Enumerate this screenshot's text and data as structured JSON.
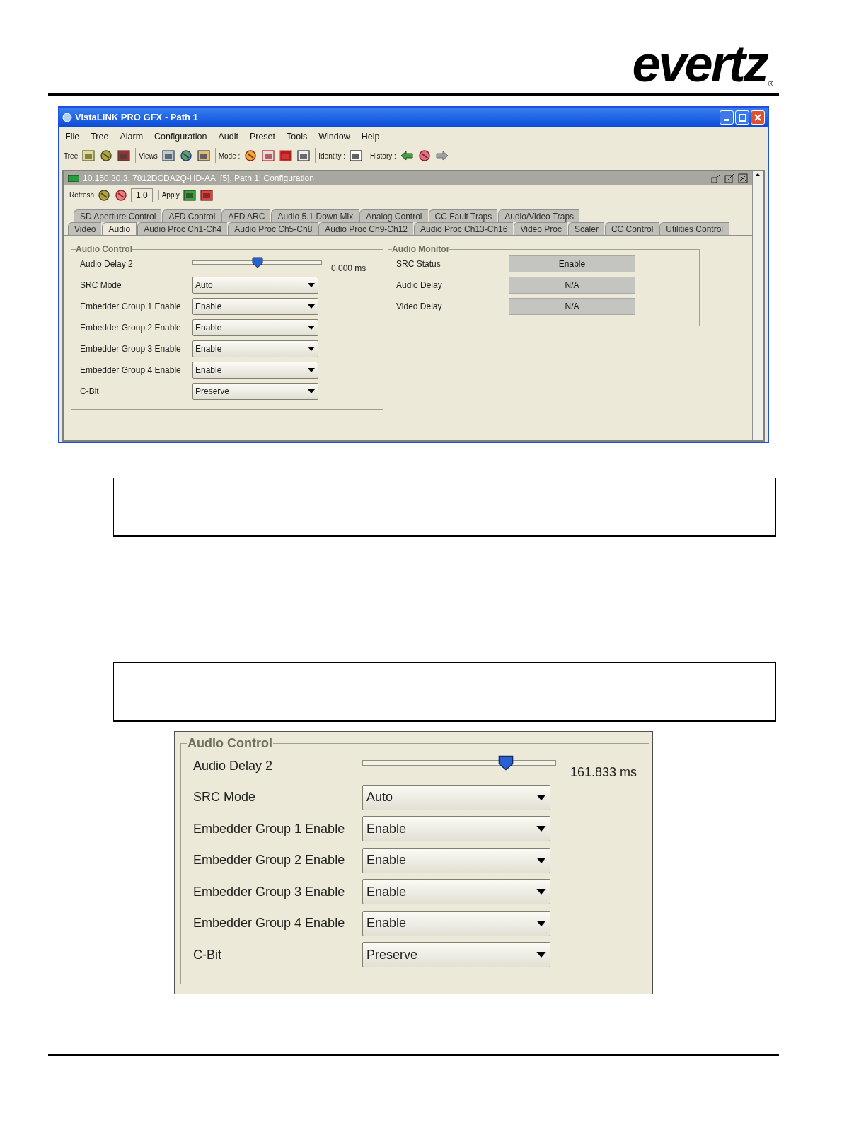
{
  "logo": {
    "text": "evertz",
    "mark": "®"
  },
  "window": {
    "title": "VistaLINK PRO GFX - Path 1"
  },
  "menu": [
    {
      "label": "File"
    },
    {
      "label": "Tree"
    },
    {
      "label": "Alarm"
    },
    {
      "label": "Configuration"
    },
    {
      "label": "Audit"
    },
    {
      "label": "Preset"
    },
    {
      "label": "Tools"
    },
    {
      "label": "Window"
    },
    {
      "label": "Help"
    }
  ],
  "toolbar": [
    {
      "label": "Tree"
    },
    {
      "label": "Views"
    },
    {
      "label": "Mode :"
    },
    {
      "label": "Identity :"
    },
    {
      "label": "History :"
    }
  ],
  "panel": {
    "title": "10.150.30.3, 7812DCDA2Q-HD-AA  [5], Path 1: Configuration",
    "refresh_label": "Refresh",
    "refresh_value": "1.0",
    "apply_label": "Apply"
  },
  "tab_rows": [
    [
      {
        "label": "SD Aperture Control",
        "selected": false
      },
      {
        "label": "AFD Control",
        "selected": false
      },
      {
        "label": "AFD ARC",
        "selected": false
      },
      {
        "label": "Audio 5.1 Down Mix",
        "selected": false
      },
      {
        "label": "Analog Control",
        "selected": false
      },
      {
        "label": "CC Fault Traps",
        "selected": false
      },
      {
        "label": "Audio/Video Traps",
        "selected": false
      }
    ],
    [
      {
        "label": "Video",
        "selected": false
      },
      {
        "label": "Audio",
        "selected": true
      },
      {
        "label": "Audio Proc Ch1-Ch4",
        "selected": false
      },
      {
        "label": "Audio Proc Ch5-Ch8",
        "selected": false
      },
      {
        "label": "Audio Proc Ch9-Ch12",
        "selected": false
      },
      {
        "label": "Audio Proc Ch13-Ch16",
        "selected": false
      },
      {
        "label": "Video Proc",
        "selected": false
      },
      {
        "label": "Scaler",
        "selected": false
      },
      {
        "label": "CC Control",
        "selected": false
      },
      {
        "label": "Utilities Control",
        "selected": false
      }
    ]
  ],
  "audio_control": {
    "title": "Audio Control",
    "rows": [
      {
        "kind": "slider",
        "label": "Audio Delay 2",
        "level": 0.5,
        "reading": "0.000 ms"
      },
      {
        "kind": "select",
        "label": "SRC Mode",
        "value": "Auto"
      },
      {
        "kind": "select",
        "label": "Embedder Group 1 Enable",
        "value": "Enable"
      },
      {
        "kind": "select",
        "label": "Embedder Group 2 Enable",
        "value": "Enable"
      },
      {
        "kind": "select",
        "label": "Embedder Group 3 Enable",
        "value": "Enable"
      },
      {
        "kind": "select",
        "label": "Embedder Group 4 Enable",
        "value": "Enable"
      },
      {
        "kind": "select",
        "label": "C-Bit",
        "value": "Preserve"
      }
    ]
  },
  "audio_monitor": {
    "title": "Audio Monitor",
    "rows": [
      {
        "label": "SRC Status",
        "value": "Enable"
      },
      {
        "label": "Audio Delay",
        "value": "N/A"
      },
      {
        "label": "Video Delay",
        "value": "N/A"
      }
    ]
  },
  "audio_control_detail": {
    "title": "Audio Control",
    "rows": [
      {
        "kind": "slider",
        "label": "Audio Delay 2",
        "level": 0.74,
        "reading": "161.833 ms"
      },
      {
        "kind": "select",
        "label": "SRC Mode",
        "value": "Auto"
      },
      {
        "kind": "select",
        "label": "Embedder Group 1 Enable",
        "value": "Enable"
      },
      {
        "kind": "select",
        "label": "Embedder Group 2 Enable",
        "value": "Enable"
      },
      {
        "kind": "select",
        "label": "Embedder Group 3 Enable",
        "value": "Enable"
      },
      {
        "kind": "select",
        "label": "Embedder Group 4 Enable",
        "value": "Enable"
      },
      {
        "kind": "select",
        "label": "C-Bit",
        "value": "Preserve"
      }
    ]
  }
}
